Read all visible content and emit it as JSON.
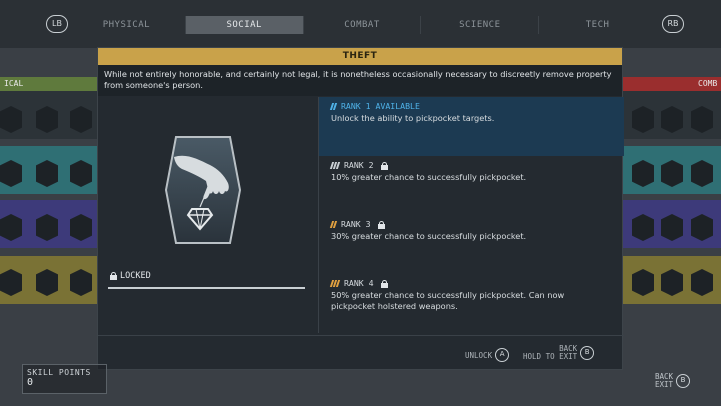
{
  "bumpers": {
    "left": "LB",
    "right": "RB"
  },
  "tabs": [
    {
      "label": "PHYSICAL",
      "active": false
    },
    {
      "label": "SOCIAL",
      "active": true
    },
    {
      "label": "COMBAT",
      "active": false
    },
    {
      "label": "SCIENCE",
      "active": false
    },
    {
      "label": "TECH",
      "active": false
    }
  ],
  "background": {
    "left_header": "ICAL",
    "right_header": "COMB"
  },
  "modal": {
    "title": "THEFT",
    "description": "While not entirely honorable, and certainly not legal, it is nonetheless occasionally necessary to discreetly remove property from someone's person.",
    "status": "LOCKED",
    "icon": "hand-grabbing-gem-icon",
    "ranks": [
      {
        "title": "RANK 1 AVAILABLE",
        "desc": "Unlock the ability to pickpocket targets.",
        "locked": false,
        "pip_color": "#4fb2e8"
      },
      {
        "title": "RANK 2",
        "desc": "10% greater chance to successfully pickpocket.",
        "locked": true,
        "pip_color": "#c9cfd3"
      },
      {
        "title": "RANK 3",
        "desc": "30% greater chance to successfully pickpocket.",
        "locked": true,
        "pip_color": "#e0a040"
      },
      {
        "title": "RANK 4",
        "desc": "50% greater chance to successfully pickpocket. Can now pickpocket holstered weapons.",
        "locked": true,
        "pip_color": "#e0a040"
      }
    ],
    "footer": {
      "unlock_label": "UNLOCK",
      "unlock_button": "A",
      "back_label": "BACK",
      "hold_label": "HOLD TO EXIT",
      "back_button": "B"
    }
  },
  "skill_points": {
    "label": "SKILL POINTS",
    "value": "0"
  },
  "bottom_right": {
    "back": "BACK",
    "exit": "EXIT",
    "button": "B"
  },
  "colors": {
    "accent_gold": "#c9a24a",
    "accent_blue": "#4fb2e8",
    "physical_column": "#5f7a3d",
    "social_row_teal": "#2f6f74",
    "social_row_purple": "#3d3a7a",
    "social_row_olive": "#7a7235",
    "combat_column": "#9a2e2e"
  }
}
